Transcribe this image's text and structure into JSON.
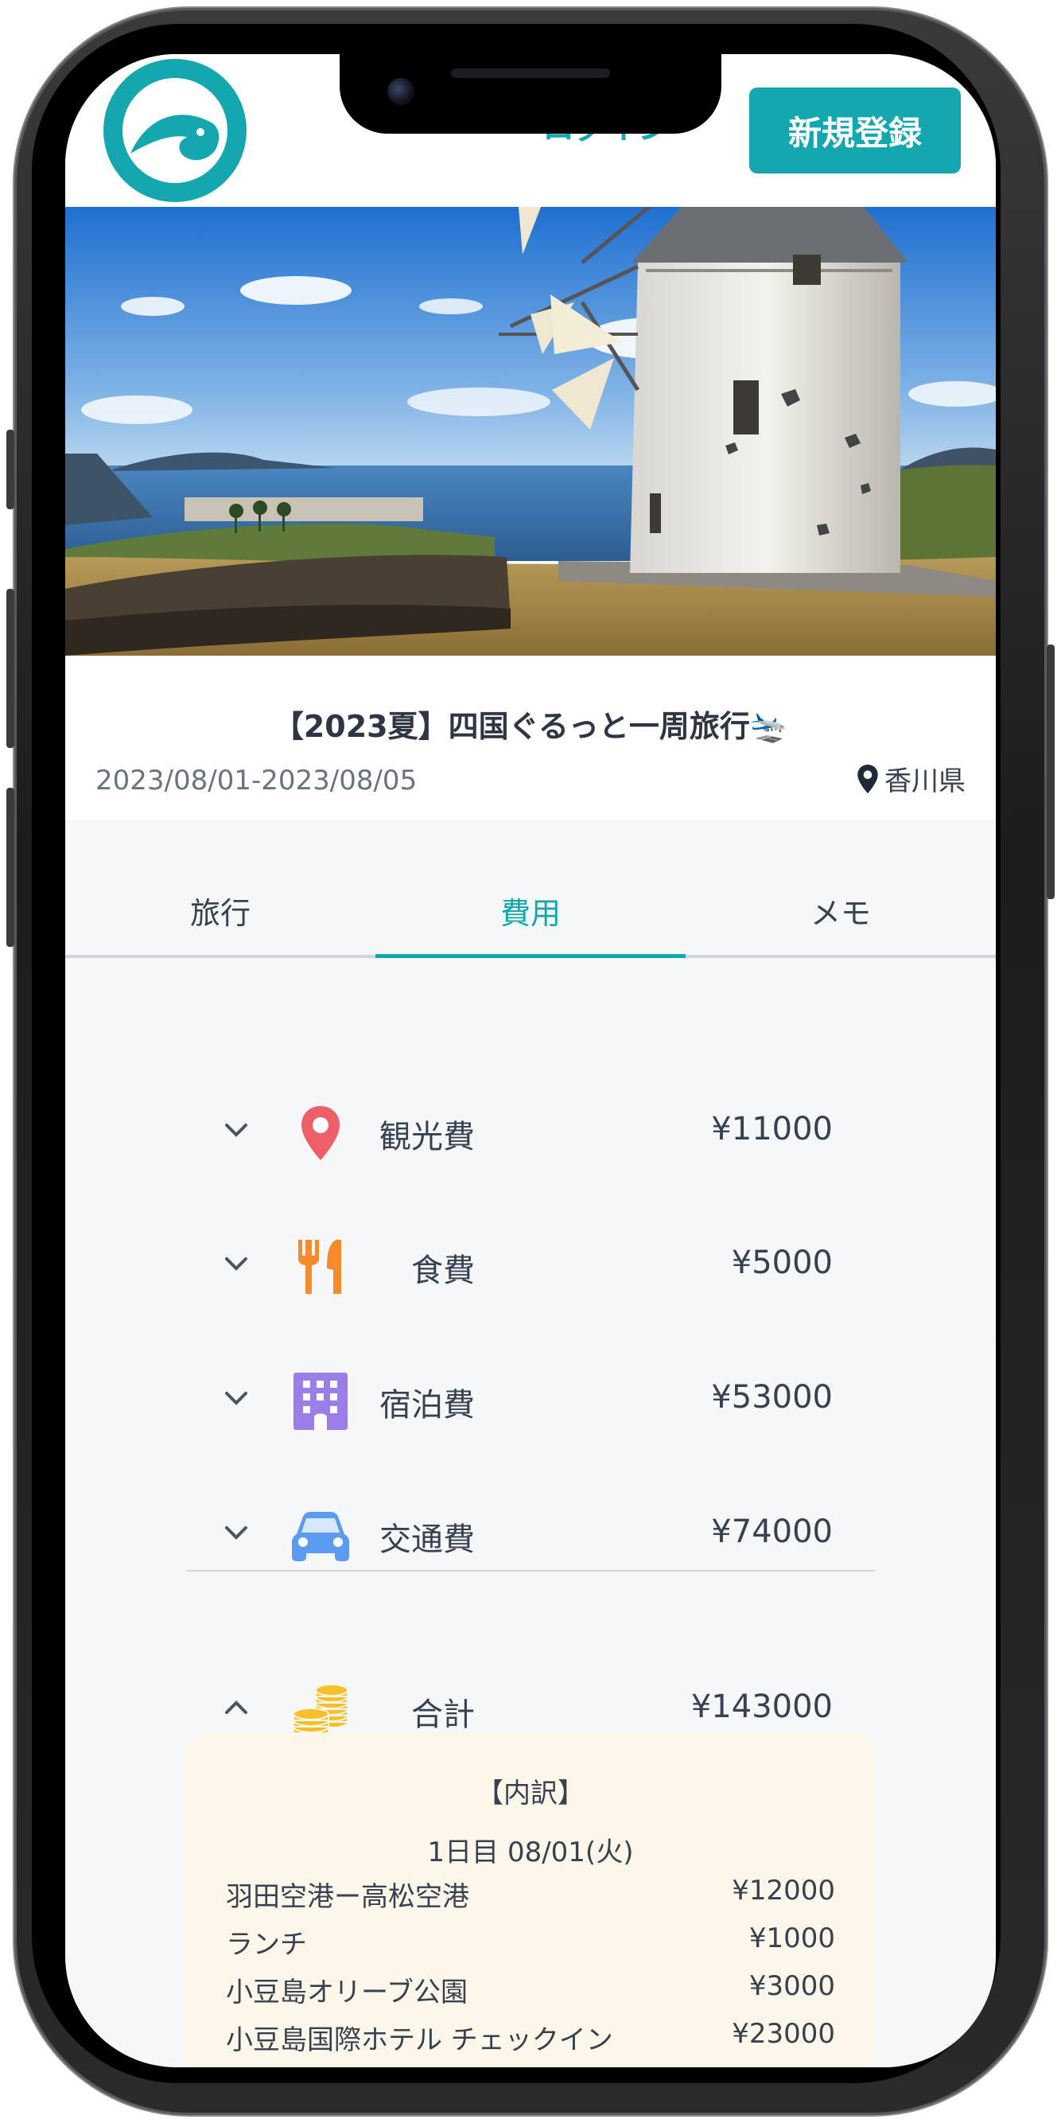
{
  "header": {
    "login_label": "ログイン",
    "signup_label": "新規登録"
  },
  "trip": {
    "title": "【2023夏】四国ぐるっと一周旅行🛬",
    "dates": "2023/08/01-2023/08/05",
    "prefecture": "香川県"
  },
  "tabs": [
    {
      "label": "旅行",
      "active": false
    },
    {
      "label": "費用",
      "active": true
    },
    {
      "label": "メモ",
      "active": false
    }
  ],
  "costs": {
    "sightseeing": {
      "label": "観光費",
      "amount": "¥11000",
      "icon": "map-pin-icon",
      "color": "#ef5f67"
    },
    "food": {
      "label": "食費",
      "amount": "¥5000",
      "icon": "fork-knife-icon",
      "color": "#f58b2b"
    },
    "lodging": {
      "label": "宿泊費",
      "amount": "¥53000",
      "icon": "hotel-icon",
      "color": "#9b7ee8"
    },
    "transport": {
      "label": "交通費",
      "amount": "¥74000",
      "icon": "car-icon",
      "color": "#5b9bf0"
    },
    "total": {
      "label": "合計",
      "amount": "¥143000",
      "icon": "coins-icon",
      "color": "#f5c02b"
    }
  },
  "breakdown": {
    "title": "【内訳】",
    "day": "1日目   08/01(火)",
    "items": [
      {
        "name": "羽田空港ー高松空港",
        "amount": "¥12000"
      },
      {
        "name": "ランチ",
        "amount": "¥1000"
      },
      {
        "name": "小豆島オリーブ公園",
        "amount": "¥3000"
      },
      {
        "name": "小豆島国際ホテル チェックイン",
        "amount": "¥23000"
      }
    ]
  },
  "colors": {
    "accent": "#14a7b0",
    "breakdown_bg": "#fcf7e9"
  }
}
